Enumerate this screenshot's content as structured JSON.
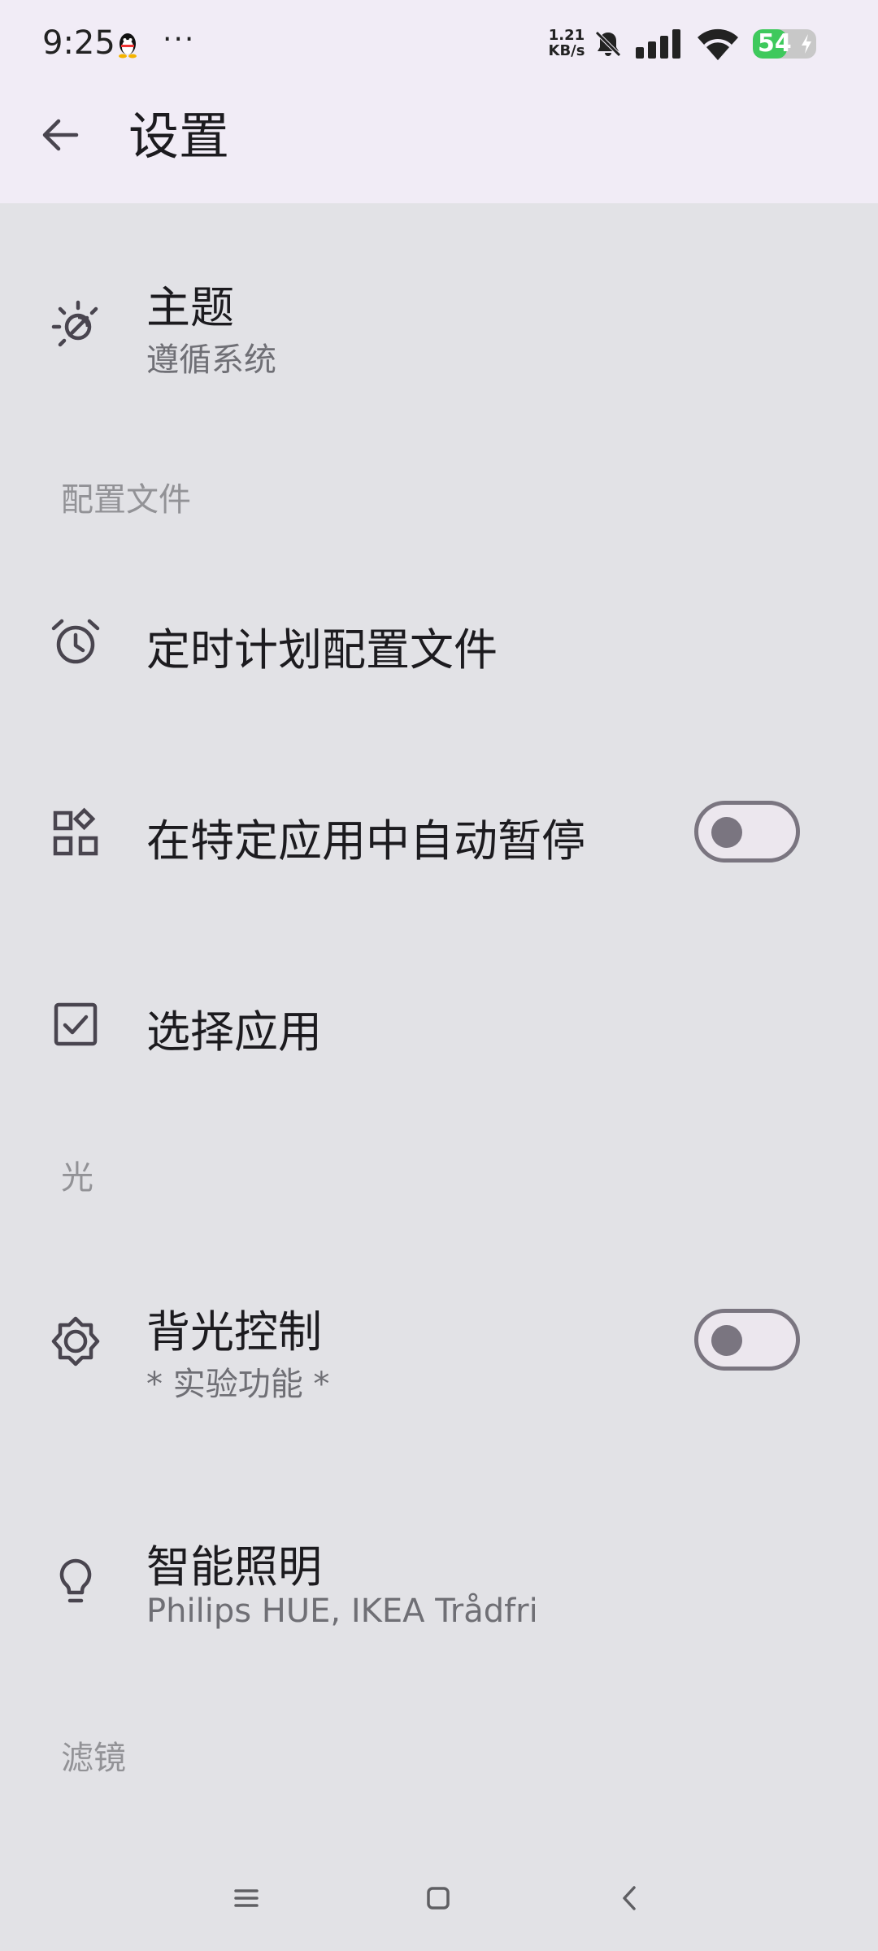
{
  "status_bar": {
    "time": "9:25",
    "more_dots": "···",
    "net_speed_value": "1.21",
    "net_speed_unit": "KB/s",
    "battery_level": "54",
    "battery_fraction": 0.54,
    "battery_color": "#3ec95c",
    "icons": [
      "qq-icon",
      "bell-off-icon",
      "cell-signal-icon",
      "wifi-icon",
      "battery-charging-icon"
    ]
  },
  "app_bar": {
    "title": "设置",
    "back_icon": "arrow-back-icon"
  },
  "settings": {
    "theme": {
      "title": "主题",
      "subtitle": "遵循系统",
      "icon": "theme-auto-icon"
    },
    "section_profiles": "配置文件",
    "scheduled_profiles": {
      "title": "定时计划配置文件",
      "icon": "alarm-clock-icon"
    },
    "auto_pause": {
      "title": "在特定应用中自动暂停",
      "icon": "apps-grid-icon",
      "enabled": false
    },
    "select_apps": {
      "title": "选择应用",
      "icon": "checkbox-icon"
    },
    "section_light": "光",
    "backlight_control": {
      "title": "背光控制",
      "subtitle": "* 实验功能 *",
      "icon": "brightness-icon",
      "enabled": false
    },
    "smart_lighting": {
      "title": "智能照明",
      "subtitle": "Philips HUE, IKEA Trådfri",
      "icon": "lightbulb-icon"
    },
    "section_filters": "滤镜"
  },
  "colors": {
    "app_bar_bg": "#f1ecf6",
    "background": "#e2e2e6",
    "switch_outline": "#7a7580"
  },
  "nav_bar": {
    "icons": [
      "menu-icon",
      "home-icon",
      "back-icon"
    ]
  }
}
